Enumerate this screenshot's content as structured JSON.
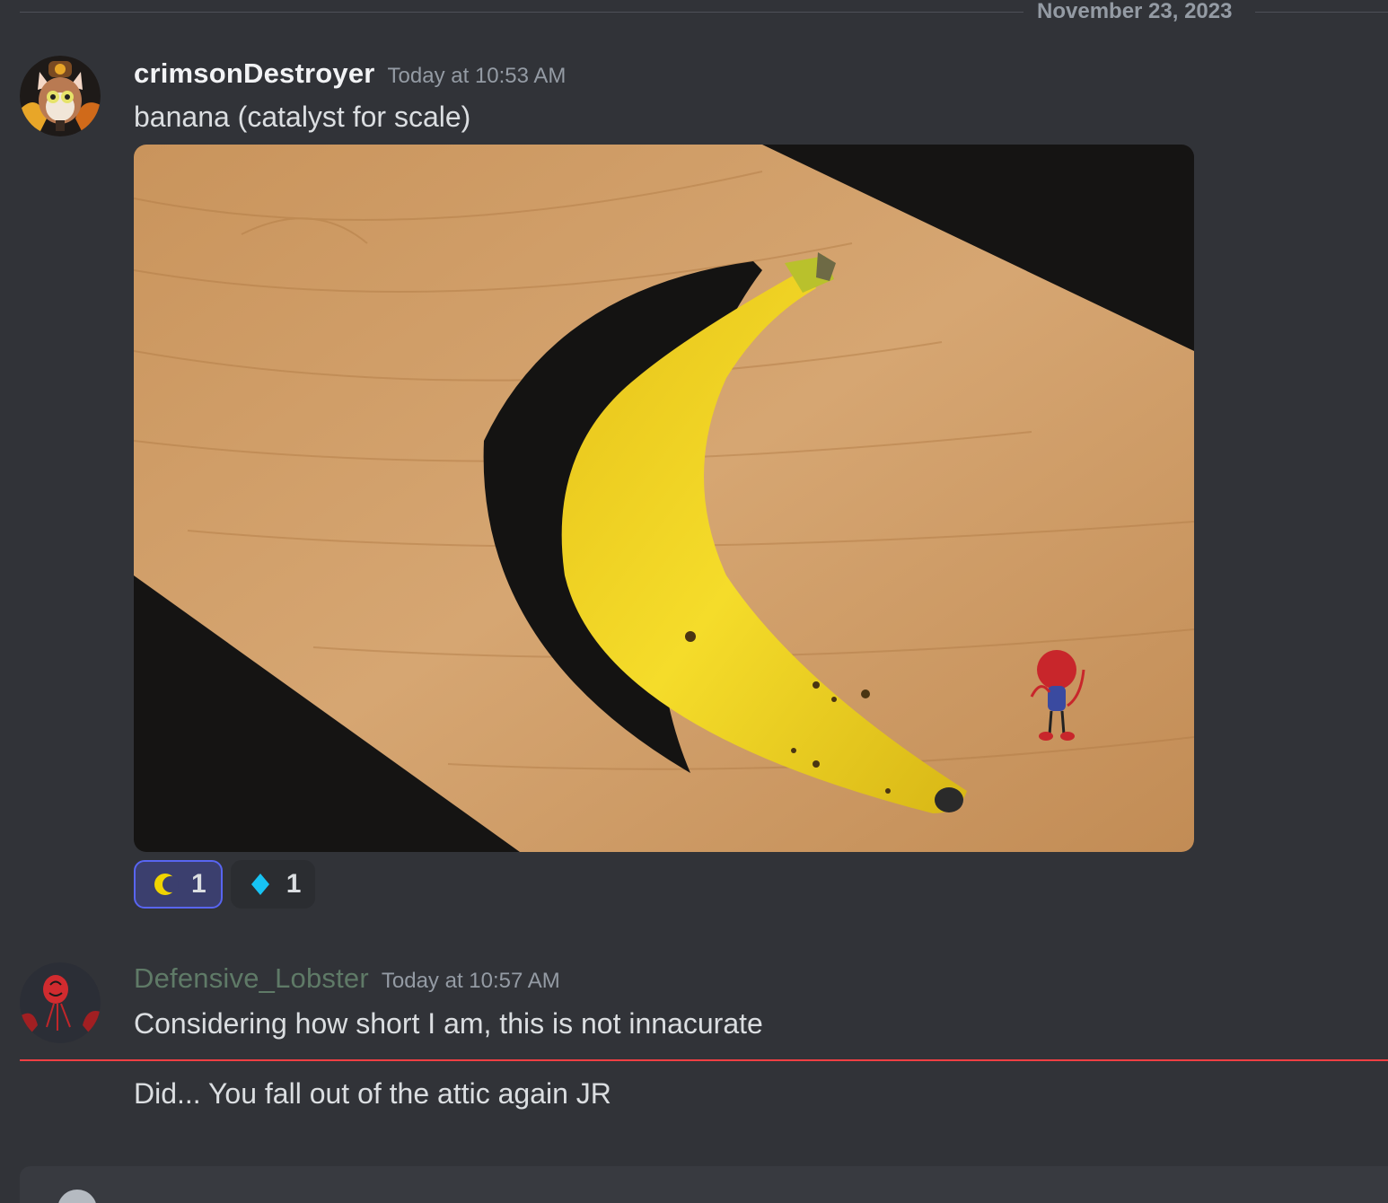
{
  "date_divider": {
    "label": "November 23, 2023"
  },
  "messages": [
    {
      "username": "crimsonDestroyer",
      "timestamp": "Today at 10:53 AM",
      "text": "banana (catalyst for scale)",
      "attachment": {
        "kind": "image",
        "subject": "banana-on-wooden-board"
      },
      "reactions": [
        {
          "icon": "crescent-moon-icon",
          "color": "#f0d400",
          "count": "1",
          "active": true
        },
        {
          "icon": "blue-diamond-icon",
          "color": "#17c3f4",
          "count": "1",
          "active": false
        }
      ]
    },
    {
      "username": "Defensive_Lobster",
      "username_color": "#5f7a67",
      "timestamp": "Today at 10:57 AM",
      "text": "Considering how short I am, this is not innacurate",
      "followup_text": "Did... You fall out of the attic again JR"
    }
  ],
  "colors": {
    "background": "#313338",
    "new_messages_line": "#f23f43",
    "reaction_active_border": "#5865f2"
  }
}
